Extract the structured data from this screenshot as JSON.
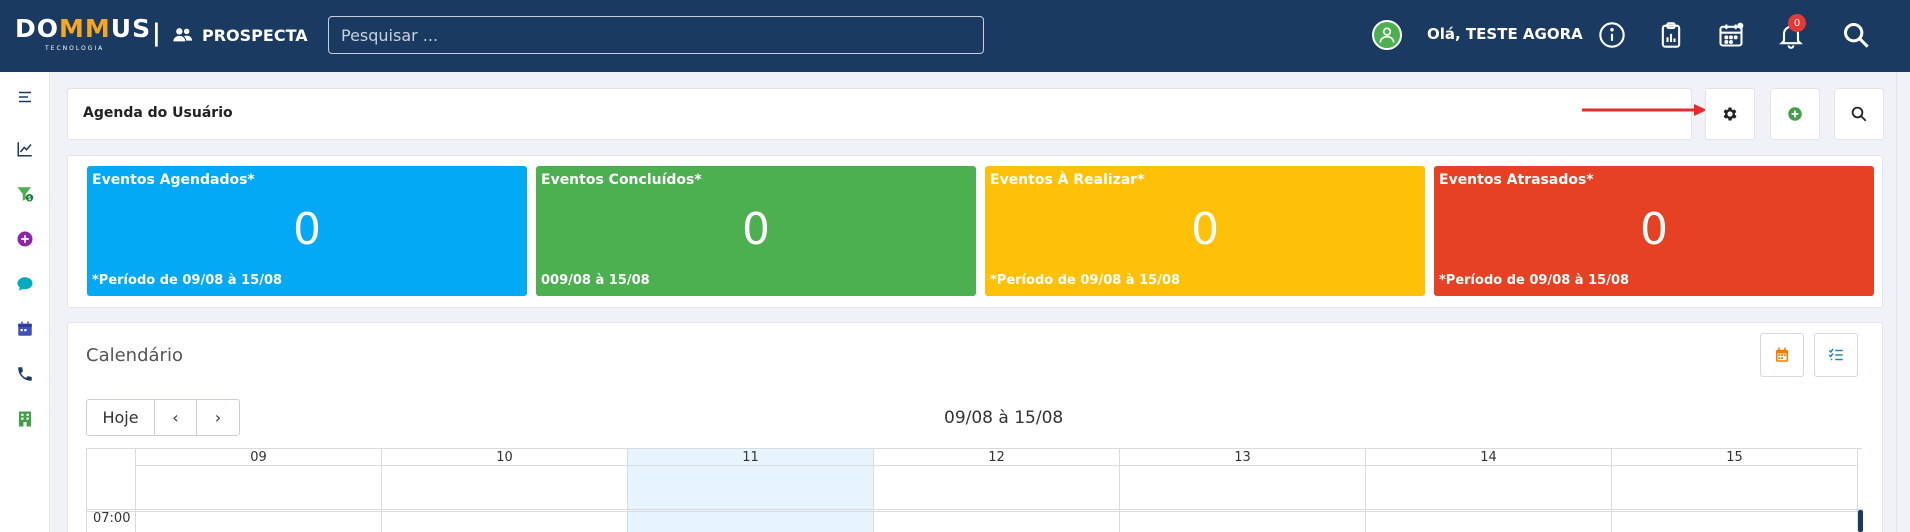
{
  "header": {
    "logo_text_1": "DO",
    "logo_text_mm": "MM",
    "logo_text_2": "US",
    "logo_sub": "TECNOLOGIA",
    "separator": "|",
    "module": "PROSPECTA",
    "search_placeholder": "Pesquisar ...",
    "greeting": "Olá, TESTE AGORA",
    "notification_count": "0",
    "icons": [
      "user-avatar-icon",
      "info-icon",
      "clipboard-chart-icon",
      "calendar-icon",
      "bell-icon",
      "search-icon"
    ]
  },
  "sidebar": {
    "items": [
      "menu-icon",
      "chart-line-icon",
      "funnel-dollar-icon",
      "plus-circle-icon",
      "chat-icon",
      "calendar-icon",
      "phone-icon",
      "building-icon"
    ]
  },
  "page": {
    "title": "Agenda do Usuário",
    "actions": [
      "settings-icon",
      "add-icon",
      "search-icon"
    ]
  },
  "kpis": [
    {
      "title": "Eventos Agendados*",
      "value": "0",
      "footer": "*Período de 09/08 à 15/08",
      "color": "#03a9f4"
    },
    {
      "title": "Eventos Concluídos*",
      "value": "0",
      "footer": "009/08 à 15/08",
      "color": "#4caf50"
    },
    {
      "title": "Eventos À Realizar*",
      "value": "0",
      "footer": "*Período de 09/08 à 15/08",
      "color": "#ffc107"
    },
    {
      "title": "Eventos Atrasados*",
      "value": "0",
      "footer": "*Período de 09/08 à 15/08",
      "color": "#e64122"
    }
  ],
  "calendar": {
    "title": "Calendário",
    "today_label": "Hoje",
    "prev_label": "‹",
    "next_label": "›",
    "range": "09/08 à 15/08",
    "days": [
      "09",
      "10",
      "11",
      "12",
      "13",
      "14",
      "15"
    ],
    "highlight_day": "11",
    "first_time": "07:00"
  }
}
